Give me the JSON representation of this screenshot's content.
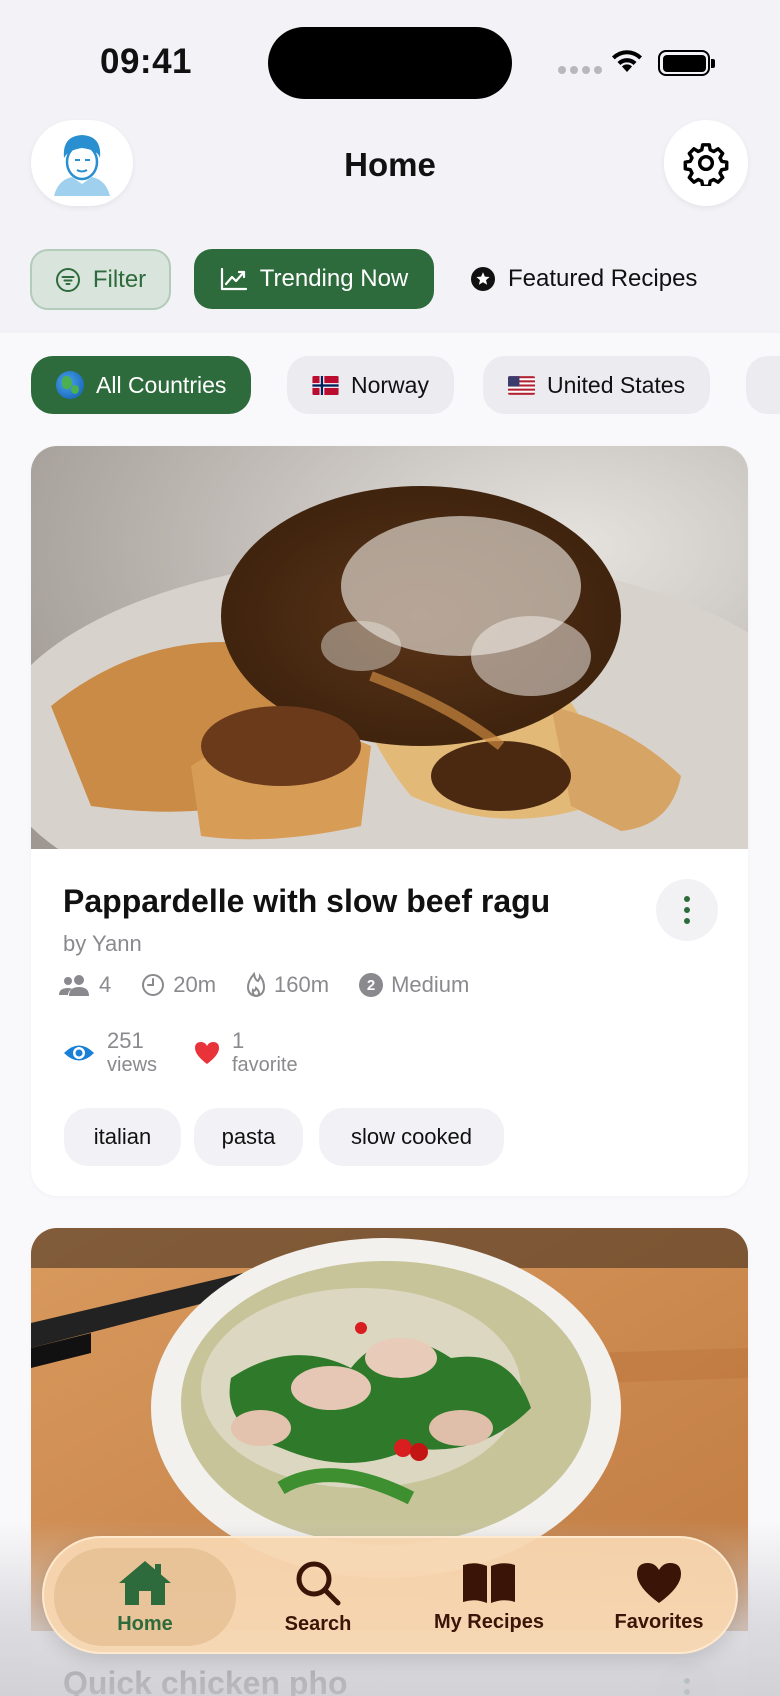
{
  "status_bar": {
    "time": "09:41"
  },
  "header": {
    "title": "Home"
  },
  "segments": {
    "filter_label": "Filter",
    "trending_label": "Trending Now",
    "featured_label": "Featured Recipes"
  },
  "countries": [
    {
      "label": "All Countries",
      "icon": "globe-icon"
    },
    {
      "label": "Norway",
      "icon": "norway-flag-icon"
    },
    {
      "label": "United States",
      "icon": "us-flag-icon"
    }
  ],
  "recipes": [
    {
      "title": "Pappardelle with slow beef ragu",
      "author": "by Yann",
      "servings": "4",
      "prep_time": "20m",
      "cook_time": "160m",
      "difficulty_level": "2",
      "difficulty": "Medium",
      "views_count": "251",
      "views_label": "views",
      "favorites_count": "1",
      "favorites_label": "favorite",
      "tags": [
        "italian",
        "pasta",
        "slow cooked"
      ]
    },
    {
      "title": "Quick chicken pho"
    }
  ],
  "tabbar": {
    "home": "Home",
    "search": "Search",
    "my_recipes": "My Recipes",
    "favorites": "Favorites"
  },
  "colors": {
    "accent_green": "#2e6b3c",
    "heart_red": "#e8333a",
    "eye_blue": "#1a7fd6",
    "tabbar_bg": "#f8d6af"
  }
}
